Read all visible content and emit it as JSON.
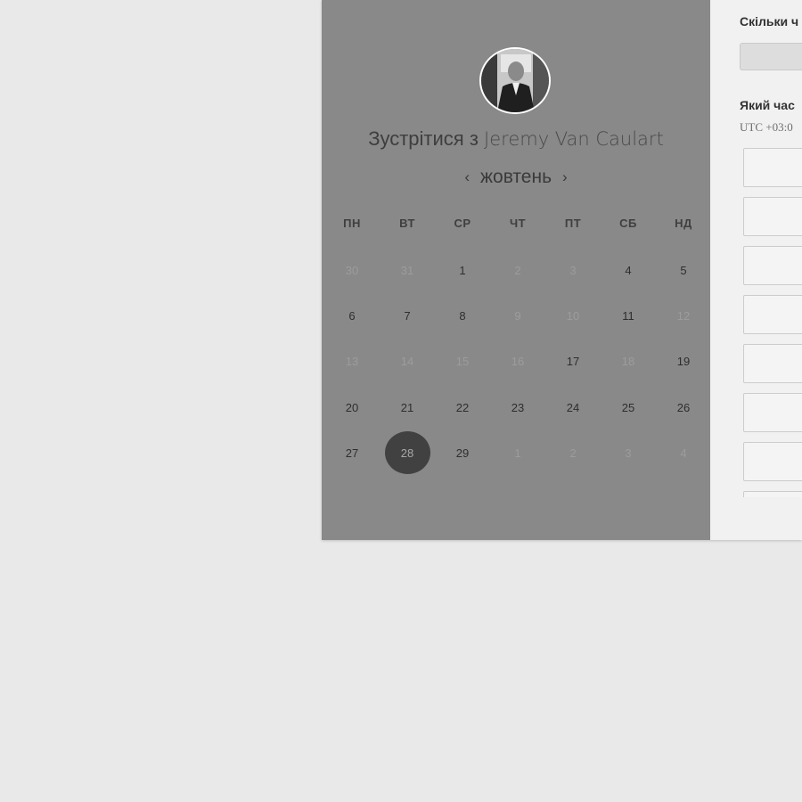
{
  "host": {
    "prefix": "Зустрітися з ",
    "name": "Jeremy Van Caulart"
  },
  "calendar": {
    "month": "жовтень",
    "prev_icon": "‹",
    "next_icon": "›",
    "weekdays": [
      "ПН",
      "ВТ",
      "СР",
      "ЧТ",
      "ПТ",
      "СБ",
      "НД"
    ],
    "weeks": [
      [
        {
          "d": "30",
          "dim": true
        },
        {
          "d": "31",
          "dim": true
        },
        {
          "d": "1",
          "dim": false
        },
        {
          "d": "2",
          "dim": true
        },
        {
          "d": "3",
          "dim": true
        },
        {
          "d": "4",
          "dim": false
        },
        {
          "d": "5",
          "dim": false
        }
      ],
      [
        {
          "d": "6",
          "dim": false
        },
        {
          "d": "7",
          "dim": false
        },
        {
          "d": "8",
          "dim": false
        },
        {
          "d": "9",
          "dim": true
        },
        {
          "d": "10",
          "dim": true
        },
        {
          "d": "11",
          "dim": false
        },
        {
          "d": "12",
          "dim": true
        }
      ],
      [
        {
          "d": "13",
          "dim": true
        },
        {
          "d": "14",
          "dim": true
        },
        {
          "d": "15",
          "dim": true
        },
        {
          "d": "16",
          "dim": true
        },
        {
          "d": "17",
          "dim": false
        },
        {
          "d": "18",
          "dim": true
        },
        {
          "d": "19",
          "dim": false
        }
      ],
      [
        {
          "d": "20",
          "dim": false
        },
        {
          "d": "21",
          "dim": false
        },
        {
          "d": "22",
          "dim": false
        },
        {
          "d": "23",
          "dim": false
        },
        {
          "d": "24",
          "dim": false
        },
        {
          "d": "25",
          "dim": false
        },
        {
          "d": "26",
          "dim": false
        }
      ],
      [
        {
          "d": "27",
          "dim": false
        },
        {
          "d": "28",
          "dim": false,
          "selected": true
        },
        {
          "d": "29",
          "dim": false
        },
        {
          "d": "1",
          "dim": true
        },
        {
          "d": "2",
          "dim": true
        },
        {
          "d": "3",
          "dim": true
        },
        {
          "d": "4",
          "dim": true
        }
      ]
    ]
  },
  "booking": {
    "duration_question": "Скільки ч",
    "time_question": "Який час",
    "timezone": "UTC +03:0",
    "slot_count": 8
  },
  "colors": {
    "overlay_panel": "#898989",
    "selected_day": "#414141",
    "page_background": "#e9e9e9"
  },
  "icons": {
    "avatar": "host-photo",
    "prev": "chevron-left-icon",
    "next": "chevron-right-icon"
  }
}
